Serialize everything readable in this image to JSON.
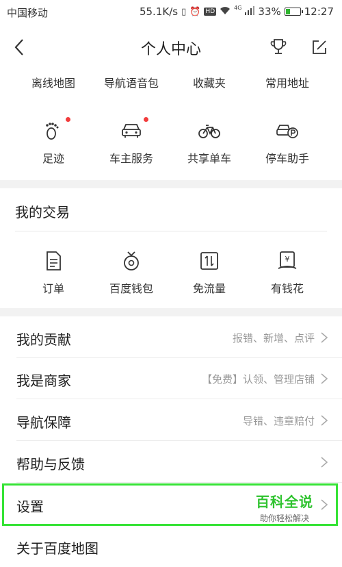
{
  "status_bar": {
    "carrier": "中国移动",
    "speed": "55.1K/s",
    "battery": "33%",
    "battery_level": 0.33,
    "time": "12:27",
    "hd": "HD",
    "network": "4G"
  },
  "nav": {
    "title": "个人中心"
  },
  "top_row": [
    {
      "label": "离线地图"
    },
    {
      "label": "导航语音包"
    },
    {
      "label": "收藏夹"
    },
    {
      "label": "常用地址"
    }
  ],
  "service_row": [
    {
      "label": "足迹",
      "icon": "footprint-icon",
      "dot": true
    },
    {
      "label": "车主服务",
      "icon": "car-icon",
      "dot": true
    },
    {
      "label": "共享单车",
      "icon": "bicycle-icon",
      "dot": false
    },
    {
      "label": "停车助手",
      "icon": "parking-icon",
      "dot": false
    }
  ],
  "trade": {
    "title": "我的交易",
    "items": [
      {
        "label": "订单",
        "icon": "order-icon"
      },
      {
        "label": "百度钱包",
        "icon": "wallet-icon"
      },
      {
        "label": "免流量",
        "icon": "free-data-icon"
      },
      {
        "label": "有钱花",
        "icon": "money-icon"
      }
    ]
  },
  "list": [
    {
      "label": "我的贡献",
      "detail": "报错、新增、点评"
    },
    {
      "label": "我是商家",
      "detail": "【免费】认领、管理店铺"
    },
    {
      "label": "导航保障",
      "detail": "导错、违章赔付"
    },
    {
      "label": "帮助与反馈",
      "detail": ""
    },
    {
      "label": "设置",
      "detail": ""
    },
    {
      "label": "关于百度地图",
      "detail": ""
    }
  ],
  "watermark": {
    "title": "百科全说",
    "subtitle": "助你轻松解决"
  },
  "colors": {
    "accent_red": "#f23c3c",
    "highlight_green": "#35e335",
    "battery_green": "#2fb52f"
  }
}
